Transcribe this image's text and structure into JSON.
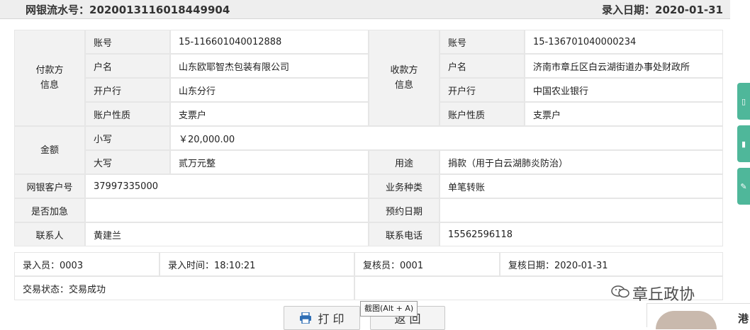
{
  "header": {
    "serial_label": "网银流水号：2020013116018449904",
    "entry_date_label": "录入日期：2020-01-31"
  },
  "payer": {
    "group_label": "付款方\n信息",
    "account_no_label": "账号",
    "account_no": "15-116601040012888",
    "name_label": "户名",
    "name": "山东欧耶智杰包装有限公司",
    "bank_label": "开户行",
    "bank": "山东分行",
    "type_label": "账户性质",
    "type": "支票户"
  },
  "payee": {
    "group_label": "收款方\n信息",
    "account_no_label": "账号",
    "account_no": "15-136701040000234",
    "name_label": "户名",
    "name": "济南市章丘区白云湖街道办事处财政所",
    "bank_label": "开户行",
    "bank": "中国农业银行",
    "type_label": "账户性质",
    "type": "支票户"
  },
  "amount": {
    "group_label": "金额",
    "small_label": "小写",
    "small": "￥20,000.00",
    "large_label": "大写",
    "large": "贰万元整",
    "purpose_label": "用途",
    "purpose": "捐款（用于白云湖肺炎防治）"
  },
  "details": {
    "customer_no_label": "网银客户号",
    "customer_no": "37997335000",
    "business_type_label": "业务种类",
    "business_type": "单笔转账",
    "urgent_label": "是否加急",
    "urgent": "",
    "scheduled_date_label": "预约日期",
    "scheduled_date": "",
    "contact_label": "联系人",
    "contact": "黄建兰",
    "phone_label": "联系电话",
    "phone": "15562596118"
  },
  "footer": {
    "entered_by": "录入员：0003",
    "entry_time": "录入时间：18:10:21",
    "reviewer": "复核员：0001",
    "review_date": "复核日期：2020-01-31",
    "status": "交易状态：交易成功"
  },
  "buttons": {
    "print": "打 印",
    "back": "返 回"
  },
  "tooltip": "截图(Alt + A)",
  "watermark": {
    "logo_text": "章丘政协"
  },
  "avatar_card": {
    "name": "港"
  },
  "colors": {
    "side_tab": "#4fb79a",
    "label_bg": "#f2f2f2",
    "print_icon": "#2f6fb5"
  }
}
